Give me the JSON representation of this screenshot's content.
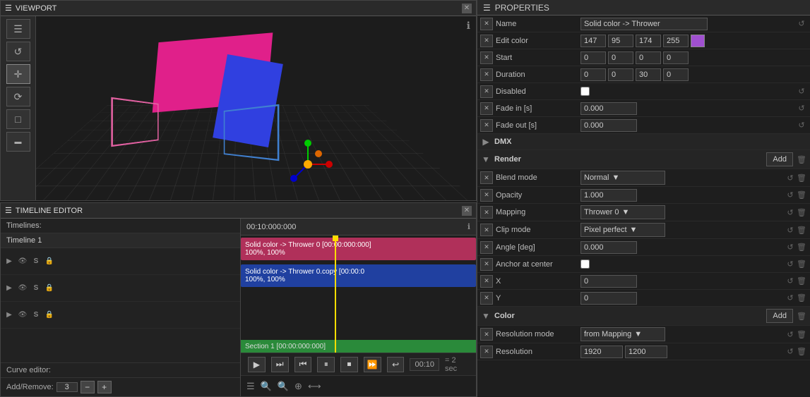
{
  "viewport": {
    "title": "VIEWPORT",
    "info_icon": "ℹ"
  },
  "timeline": {
    "title": "TIMELINE EDITOR",
    "timelines_label": "Timelines:",
    "timeline_item": "Timeline 1",
    "curve_editor": "Curve editor:",
    "time_display": "00:10",
    "section_display": "= 2 sec",
    "header_time": "00:10:000:000",
    "track1_label": "Solid color -> Thrower 0 [00:00:000:000]\n100%, 100%",
    "track2_label": "Solid color -> Thrower 0.copy [00:00:0\n100%, 100%",
    "section_label": "Section 1 [00:00:000:000]",
    "add_remove_label": "Add/Remove:",
    "add_remove_val": "3"
  },
  "properties": {
    "title": "PROPERTIES",
    "name_label": "Name",
    "name_value": "Solid color -> Thrower",
    "edit_color_label": "Edit color",
    "edit_color_r": "147",
    "edit_color_g": "95",
    "edit_color_b": "174",
    "edit_color_a": "255",
    "start_label": "Start",
    "start_v1": "0",
    "start_v2": "0",
    "start_v3": "0",
    "start_v4": "0",
    "duration_label": "Duration",
    "duration_v1": "0",
    "duration_v2": "0",
    "duration_v3": "30",
    "duration_v4": "0",
    "disabled_label": "Disabled",
    "fade_in_label": "Fade in [s]",
    "fade_in_val": "0.000",
    "fade_out_label": "Fade out [s]",
    "fade_out_val": "0.000",
    "dmx_label": "DMX",
    "render_label": "Render",
    "render_add": "Add",
    "blend_mode_label": "Blend mode",
    "blend_mode_val": "Normal",
    "opacity_label": "Opacity",
    "opacity_val": "1.000",
    "mapping_label": "Mapping",
    "mapping_val": "Thrower 0",
    "clip_mode_label": "Clip mode",
    "clip_mode_val": "Pixel perfect",
    "angle_label": "Angle [deg]",
    "angle_val": "0.000",
    "anchor_label": "Anchor at center",
    "x_label": "X",
    "x_val": "0",
    "y_label": "Y",
    "y_val": "0",
    "color_label": "Color",
    "color_add": "Add",
    "resolution_mode_label": "Resolution mode",
    "resolution_mode_val": "from Mapping",
    "resolution_label": "Resolution",
    "resolution_w": "1920",
    "resolution_h": "1200"
  },
  "tools": {
    "hamburger": "☰",
    "rotate": "↺",
    "move": "✛",
    "rotate2": "⟳",
    "square": "□",
    "rectangle": "▬"
  }
}
